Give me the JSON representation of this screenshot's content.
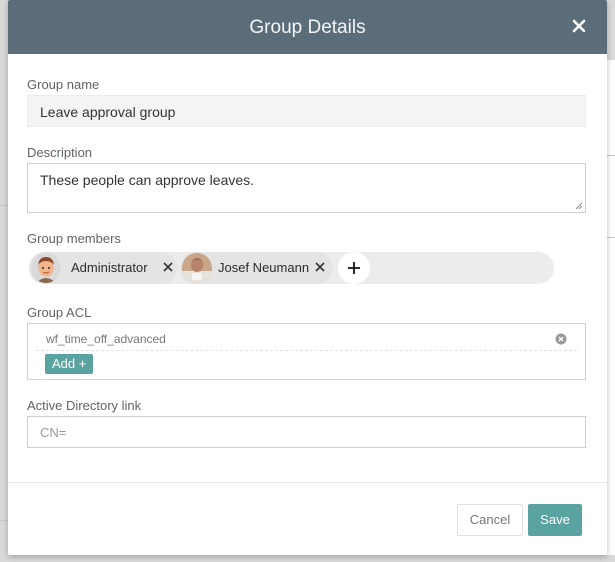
{
  "dialog": {
    "title": "Group Details",
    "close_icon": "close-icon"
  },
  "group_name": {
    "label": "Group name",
    "value": "Leave approval group"
  },
  "description": {
    "label": "Description",
    "value": "These people can approve leaves."
  },
  "members": {
    "label": "Group members",
    "items": [
      {
        "name": "Administrator",
        "avatar": "avatar-administrator"
      },
      {
        "name": "Josef Neumann",
        "avatar": "avatar-josef-neumann"
      }
    ],
    "add_icon": "plus-icon"
  },
  "acl": {
    "label": "Group ACL",
    "items": [
      "wf_time_off_advanced"
    ],
    "add_label": "Add +"
  },
  "ad_link": {
    "label": "Active Directory link",
    "placeholder": "CN="
  },
  "footer": {
    "cancel_label": "Cancel",
    "save_label": "Save"
  },
  "colors": {
    "header": "#5b6d79",
    "accent": "#5aa3a0"
  }
}
